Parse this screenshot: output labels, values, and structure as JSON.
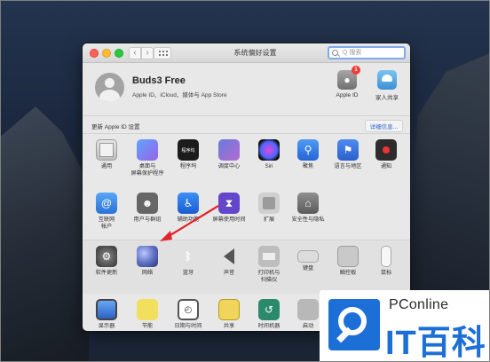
{
  "window": {
    "title": "系统偏好设置",
    "search_placeholder": "Q 搜索"
  },
  "account": {
    "name": "Buds3 Free",
    "subtitle": "Apple ID、iCloud、媒体与 App Store",
    "apple_id_label": "Apple ID",
    "apple_id_badge": "1",
    "family_label": "家人共享"
  },
  "update_bar": {
    "text": "更新 Apple ID 设置",
    "button": "详细信息..."
  },
  "rows": [
    [
      {
        "label": "通用",
        "icon": "general-icon"
      },
      {
        "label": "桌面与\n屏幕保护程序",
        "icon": "desktop-icon"
      },
      {
        "label": "程序坞",
        "icon": "dock-icon"
      },
      {
        "label": "调度中心",
        "icon": "mission-control-icon"
      },
      {
        "label": "Siri",
        "icon": "siri-icon"
      },
      {
        "label": "聚焦",
        "icon": "spotlight-icon"
      },
      {
        "label": "语言与地区",
        "icon": "language-icon"
      },
      {
        "label": "通知",
        "icon": "notifications-icon"
      }
    ],
    [
      {
        "label": "互联网\n帐户",
        "icon": "internet-accounts-icon"
      },
      {
        "label": "用户与群组",
        "icon": "users-groups-icon"
      },
      {
        "label": "辅助功能",
        "icon": "accessibility-icon"
      },
      {
        "label": "屏幕使用时间",
        "icon": "screen-time-icon"
      },
      {
        "label": "扩展",
        "icon": "extensions-icon"
      },
      {
        "label": "安全性与隐私",
        "icon": "security-icon"
      }
    ],
    [
      {
        "label": "软件更新",
        "icon": "software-update-icon"
      },
      {
        "label": "网络",
        "icon": "network-icon"
      },
      {
        "label": "蓝牙",
        "icon": "bluetooth-icon"
      },
      {
        "label": "声音",
        "icon": "sound-icon"
      },
      {
        "label": "打印机与\n扫描仪",
        "icon": "printers-icon"
      },
      {
        "label": "键盘",
        "icon": "keyboard-icon"
      },
      {
        "label": "触控板",
        "icon": "trackpad-icon"
      },
      {
        "label": "鼠标",
        "icon": "mouse-icon"
      }
    ],
    [
      {
        "label": "显示器",
        "icon": "displays-icon"
      },
      {
        "label": "节能",
        "icon": "energy-saver-icon"
      },
      {
        "label": "日期与时间",
        "icon": "date-time-icon"
      },
      {
        "label": "共享",
        "icon": "sharing-icon"
      },
      {
        "label": "时间机器",
        "icon": "time-machine-icon"
      },
      {
        "label": "启动",
        "icon": "startup-disk-icon"
      }
    ]
  ],
  "icon_glyphs": {
    "dock": "程序坞",
    "general": "File",
    "bluetooth": "ᛒ"
  },
  "watermark": {
    "small": "PConline",
    "big": "IT百科"
  },
  "colors": {
    "arrow": "#e0262b",
    "accent": "#1d6fd8"
  }
}
